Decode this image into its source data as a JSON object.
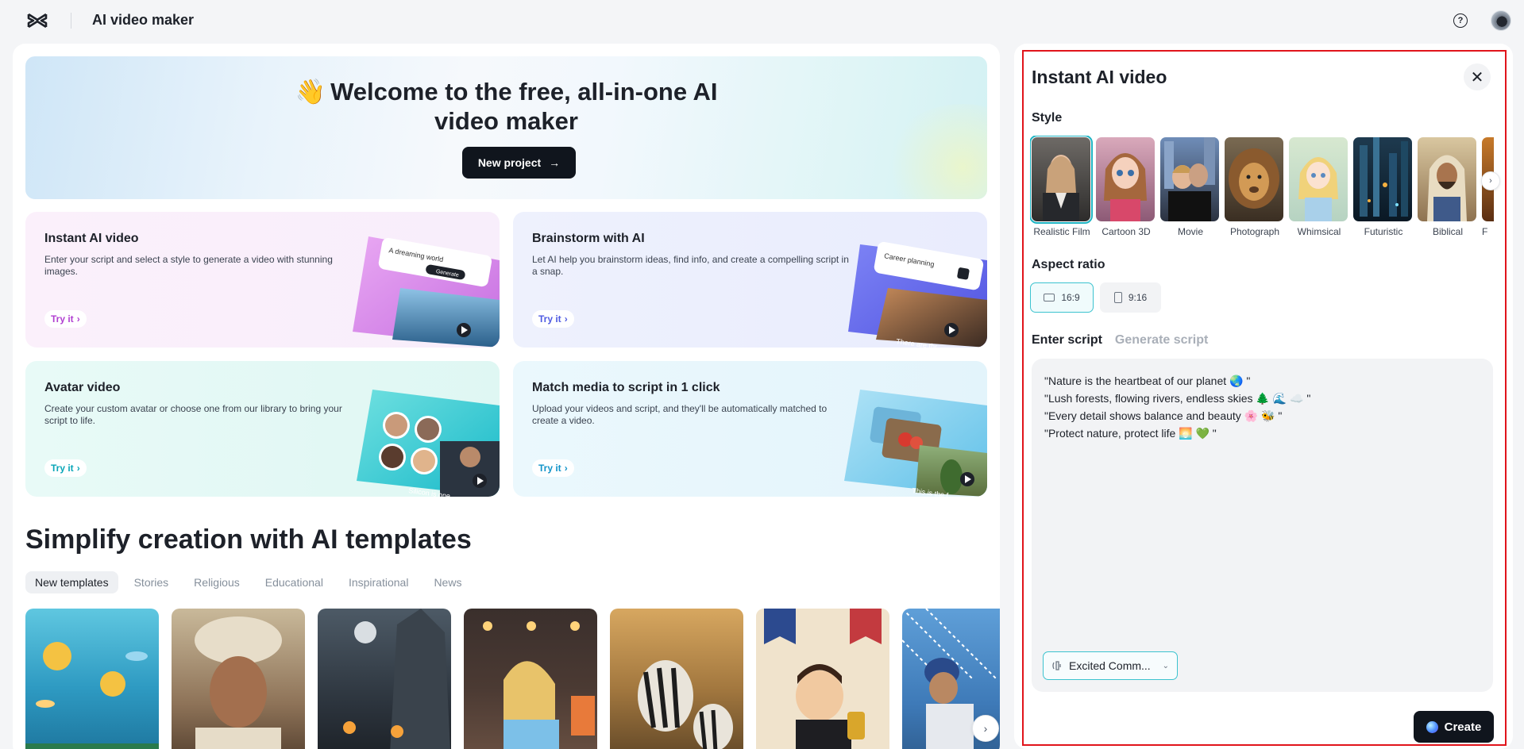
{
  "header": {
    "app_title": "AI video maker"
  },
  "hero": {
    "wave": "👋",
    "title_line1": "Welcome to the free, all-in-one AI",
    "title_line2": "video maker",
    "cta_label": "New project"
  },
  "feature_cards": [
    {
      "title": "Instant AI video",
      "desc": "Enter your script and select a style to generate a video with stunning images.",
      "try_label": "Try it",
      "art_text": "A dreaming world",
      "art_button": "Generate"
    },
    {
      "title": "Brainstorm with AI",
      "desc": "Let AI help you brainstorm ideas, find info, and create a compelling script in a snap.",
      "try_label": "Try it",
      "art_text": "Career planning",
      "art_caption": "There are thr"
    },
    {
      "title": "Avatar video",
      "desc": "Create your custom avatar or choose one from our library to bring your script to life.",
      "try_label": "Try it",
      "art_caption": "Silicon is one"
    },
    {
      "title": "Match media to script in 1 click",
      "desc": "Upload your videos and script, and they'll be automatically matched to create a video.",
      "try_label": "Try it",
      "art_caption": "This is the f"
    }
  ],
  "templates_section": {
    "title": "Simplify creation with AI templates",
    "filters": [
      "New templates",
      "Stories",
      "Religious",
      "Educational",
      "Inspirational",
      "News"
    ],
    "active_filter": "New templates"
  },
  "panel": {
    "title": "Instant AI video",
    "style_label": "Style",
    "styles": [
      "Realistic Film",
      "Cartoon 3D",
      "Movie",
      "Photograph",
      "Whimsical",
      "Futuristic",
      "Biblical",
      "F"
    ],
    "selected_style": "Realistic Film",
    "aspect_label": "Aspect ratio",
    "aspect_options": [
      "16:9",
      "9:16"
    ],
    "selected_aspect": "16:9",
    "tab_enter": "Enter script",
    "tab_generate": "Generate script",
    "script_lines": [
      "\"Nature is the heartbeat of our planet 🌏 \"",
      "\"Lush forests, flowing rivers, endless skies 🌲 🌊 ☁️ \"",
      "\"Every detail shows balance and beauty 🌸 🐝 \"",
      "\"Protect nature, protect life 🌅 💚 \""
    ],
    "voice_label": "Excited Comm...",
    "create_label": "Create"
  }
}
